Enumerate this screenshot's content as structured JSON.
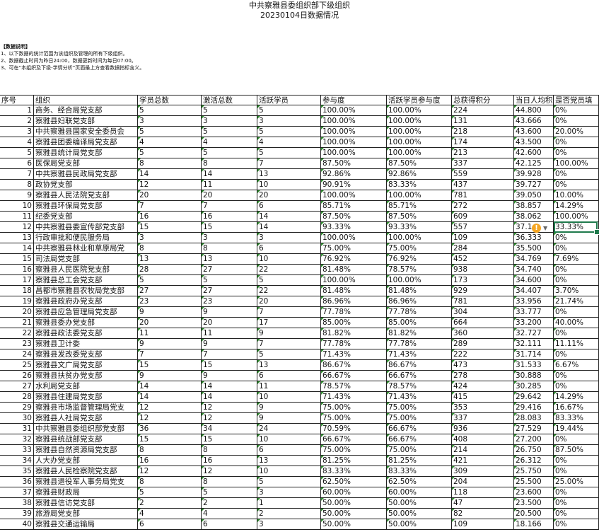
{
  "title": "中共察雅县委组织部下级组织",
  "subtitle": "20230104日数据情况",
  "notes": {
    "heading": "【数据说明】",
    "lines": [
      "1、以下数据的统计范围为该组织及管理的所有下级组织。",
      "2、数据截止时间为昨日24:00，数据更新时间为每日07:00。",
      "3、可在“本组织及下级-学情分析”页面最上方查看数据指标含义。"
    ]
  },
  "columns": [
    "序号",
    "组织",
    "学员总数",
    "激活总数",
    "活跃学员",
    "参与度",
    "活跃学员参与度",
    "总获得积分",
    "当日人均积",
    "是否党员填"
  ],
  "rows": [
    [
      "1",
      "商务、经合局党支部",
      "5",
      "5",
      "5",
      "100.00%",
      "100.00%",
      "224",
      "44.800",
      "0%"
    ],
    [
      "2",
      "察雅县妇联党支部",
      "3",
      "3",
      "3",
      "100.00%",
      "100.00%",
      "131",
      "43.666",
      "0%"
    ],
    [
      "3",
      "中共察雅县国家安全委员会",
      "5",
      "5",
      "5",
      "100.00%",
      "100.00%",
      "218",
      "43.600",
      "20.00%"
    ],
    [
      "4",
      "察雅县团委编译局党支部",
      "4",
      "4",
      "4",
      "100.00%",
      "100.00%",
      "174",
      "43.500",
      "0%"
    ],
    [
      "5",
      "察雅县统计局党支部",
      "5",
      "5",
      "5",
      "100.00%",
      "100.00%",
      "213",
      "42.600",
      "0%"
    ],
    [
      "6",
      "医保局党支部",
      "8",
      "8",
      "7",
      "87.50%",
      "87.50%",
      "337",
      "42.125",
      "100.00%"
    ],
    [
      "7",
      "中共察雅县民政局党支部",
      "14",
      "14",
      "13",
      "92.86%",
      "92.86%",
      "559",
      "39.928",
      "0%"
    ],
    [
      "8",
      "政协党支部",
      "12",
      "11",
      "10",
      "90.91%",
      "83.33%",
      "437",
      "39.727",
      "0%"
    ],
    [
      "9",
      "察雅县人民法院党支部",
      "20",
      "20",
      "20",
      "100.00%",
      "100.00%",
      "781",
      "39.050",
      "10.00%"
    ],
    [
      "10",
      "察雅县环保局党支部",
      "7",
      "7",
      "6",
      "85.71%",
      "85.71%",
      "272",
      "38.857",
      "14.29%"
    ],
    [
      "11",
      "纪委党支部",
      "16",
      "16",
      "14",
      "87.50%",
      "87.50%",
      "609",
      "38.062",
      "100.00%"
    ],
    [
      "12",
      "中共察雅县委宣传部党支部",
      "15",
      "15",
      "14",
      "93.33%",
      "93.33%",
      "557",
      "37.1",
      "33.33%"
    ],
    [
      "13",
      "行政审批和便民服务局",
      "3",
      "3",
      "3",
      "100.00%",
      "100.00%",
      "109",
      "36.333",
      "0%"
    ],
    [
      "14",
      "中共察雅县林业和草原局党",
      "8",
      "8",
      "6",
      "75.00%",
      "75.00%",
      "284",
      "35.500",
      "0%"
    ],
    [
      "15",
      "司法局党支部",
      "13",
      "13",
      "10",
      "76.92%",
      "76.92%",
      "452",
      "34.769",
      "7.69%"
    ],
    [
      "16",
      "察雅县人民医院党支部",
      "28",
      "27",
      "22",
      "81.48%",
      "78.57%",
      "938",
      "34.740",
      "0%"
    ],
    [
      "17",
      "察雅县总工会党支部",
      "5",
      "5",
      "5",
      "100.00%",
      "100.00%",
      "173",
      "34.600",
      "0%"
    ],
    [
      "18",
      "昌都市察雅县农牧局党支部",
      "27",
      "27",
      "22",
      "81.48%",
      "81.48%",
      "929",
      "34.407",
      "3.70%"
    ],
    [
      "19",
      "察雅县政府办党支部",
      "23",
      "23",
      "20",
      "86.96%",
      "86.96%",
      "781",
      "33.956",
      "21.74%"
    ],
    [
      "20",
      "察雅县应急管理局党支部",
      "9",
      "9",
      "7",
      "77.78%",
      "77.78%",
      "304",
      "33.777",
      "0%"
    ],
    [
      "21",
      "察雅县委办党支部",
      "20",
      "20",
      "17",
      "85.00%",
      "85.00%",
      "664",
      "33.200",
      "40.00%"
    ],
    [
      "22",
      "察雅县政法委党支部",
      "11",
      "11",
      "9",
      "81.82%",
      "81.82%",
      "360",
      "32.727",
      "0%"
    ],
    [
      "23",
      "察雅县卫计委",
      "9",
      "9",
      "7",
      "77.78%",
      "77.78%",
      "289",
      "32.111",
      "11.11%"
    ],
    [
      "24",
      "察雅县发改委党支部",
      "7",
      "7",
      "5",
      "71.43%",
      "71.43%",
      "222",
      "31.714",
      "0%"
    ],
    [
      "25",
      "察雅县文广局党支部",
      "15",
      "15",
      "13",
      "86.67%",
      "86.67%",
      "473",
      "31.533",
      "6.67%"
    ],
    [
      "26",
      "察雅县扶贫办党支部",
      "9",
      "9",
      "6",
      "66.67%",
      "66.67%",
      "278",
      "30.888",
      "0%"
    ],
    [
      "27",
      "水利局党支部",
      "14",
      "14",
      "11",
      "78.57%",
      "78.57%",
      "424",
      "30.285",
      "0%"
    ],
    [
      "28",
      "察雅县住建局党支部",
      "14",
      "14",
      "10",
      "71.43%",
      "71.43%",
      "415",
      "29.642",
      "14.29%"
    ],
    [
      "29",
      "察雅县市场监督管理局党支",
      "12",
      "12",
      "9",
      "75.00%",
      "75.00%",
      "353",
      "29.416",
      "16.67%"
    ],
    [
      "30",
      "察雅县人社局党支部",
      "12",
      "12",
      "9",
      "75.00%",
      "75.00%",
      "337",
      "28.083",
      "83.33%"
    ],
    [
      "31",
      "中共察雅县委组织部党支部",
      "36",
      "34",
      "24",
      "70.59%",
      "66.67%",
      "936",
      "27.529",
      "19.44%"
    ],
    [
      "32",
      "察雅县统战部党支部",
      "15",
      "15",
      "10",
      "66.67%",
      "66.67%",
      "408",
      "27.200",
      "0%"
    ],
    [
      "33",
      "察雅县自然资源局党支部",
      "8",
      "8",
      "6",
      "75.00%",
      "75.00%",
      "214",
      "26.750",
      "87.50%"
    ],
    [
      "34",
      "人大办党支部",
      "16",
      "16",
      "13",
      "81.25%",
      "81.25%",
      "421",
      "26.312",
      "0%"
    ],
    [
      "35",
      "察雅县人民检察院党支部",
      "12",
      "12",
      "10",
      "83.33%",
      "83.33%",
      "309",
      "25.750",
      "0%"
    ],
    [
      "36",
      "察雅县退役军人事务局党支",
      "8",
      "8",
      "5",
      "62.50%",
      "62.50%",
      "204",
      "25.500",
      "25.00%"
    ],
    [
      "37",
      "察雅县财政局",
      "5",
      "5",
      "3",
      "60.00%",
      "60.00%",
      "118",
      "23.600",
      "0%"
    ],
    [
      "38",
      "察雅县信访党支部",
      "2",
      "2",
      "1",
      "50.00%",
      "50.00%",
      "47",
      "23.500",
      "0%"
    ],
    [
      "39",
      "旅游局党支部",
      "4",
      "4",
      "2",
      "50.00%",
      "50.00%",
      "82",
      "20.500",
      "0%"
    ],
    [
      "40",
      "察雅县交通运输局",
      "6",
      "6",
      "3",
      "50.00%",
      "50.00%",
      "109",
      "18.166",
      "0%"
    ]
  ],
  "accent_color": "#1f7a4c",
  "warning_icon": "warning-icon"
}
